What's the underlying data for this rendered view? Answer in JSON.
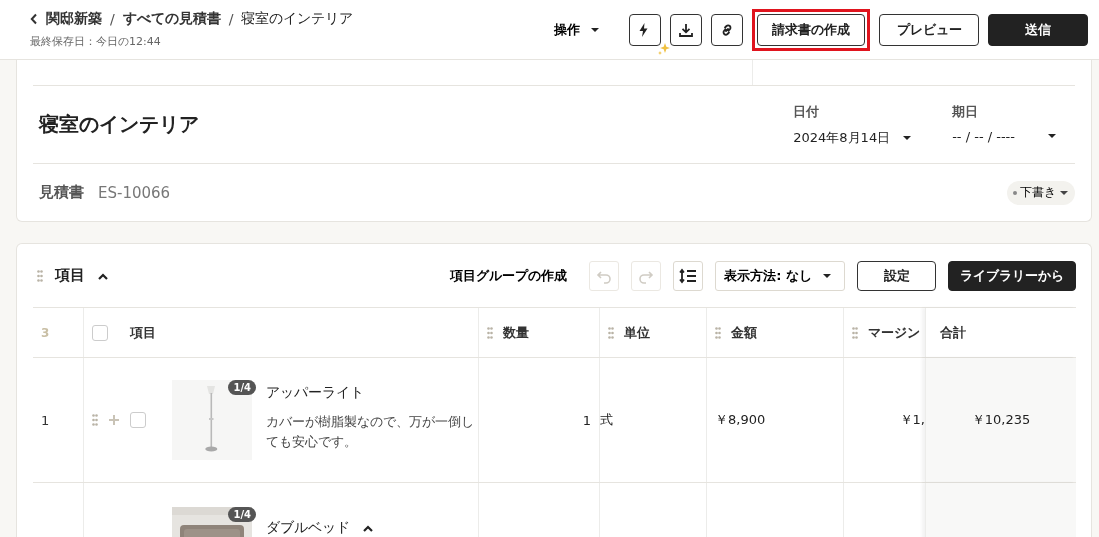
{
  "header": {
    "breadcrumbs": [
      "関邸新築",
      "すべての見積書",
      "寝室のインテリア"
    ],
    "separator": "/",
    "saved": "最終保存日：今日の12:44",
    "actions_menu": "操作",
    "icon_buttons": [
      {
        "kind": "bolt"
      },
      {
        "kind": "download"
      },
      {
        "kind": "link"
      }
    ],
    "buttons": [
      {
        "label": "請求書の作成",
        "kind": "outline",
        "highlighted": true
      },
      {
        "label": "プレビュー",
        "kind": "outline",
        "highlighted": false
      },
      {
        "label": "送信",
        "kind": "primary",
        "highlighted": false
      }
    ]
  },
  "document": {
    "title": "寝室のインテリア",
    "date_fields": [
      {
        "label": "日付",
        "value": "2024年8月14日"
      },
      {
        "label": "期日",
        "value": "-- / -- / ----"
      }
    ],
    "doc_type": "見積書",
    "number": "ES-10066",
    "status": "下書き"
  },
  "items": {
    "title": "項目",
    "expanded": true,
    "create_group": "項目グループの作成",
    "undo": {
      "disabled": true
    },
    "redo": {
      "disabled": true
    },
    "display": "表示方法: なし",
    "settings": "設定",
    "library": "ライブラリーから",
    "table": {
      "count": "3",
      "header_checked": false,
      "columns": [
        "項目",
        "数量",
        "単位",
        "金額",
        "マージン",
        "合計"
      ],
      "rows": [
        {
          "number": "1",
          "hovered": true,
          "checked": false,
          "badge": "1/4",
          "name": "アッパーライト",
          "description": "カバーが樹脂製なので、万が一倒しても安心です。",
          "quantity": "1",
          "unit": "式",
          "amount": "￥8,900",
          "margin": "￥1,",
          "total": "￥10,235"
        },
        {
          "hovered": false,
          "badge": "1/4",
          "name": "ダブルベッド",
          "expanded": true
        }
      ]
    }
  }
}
